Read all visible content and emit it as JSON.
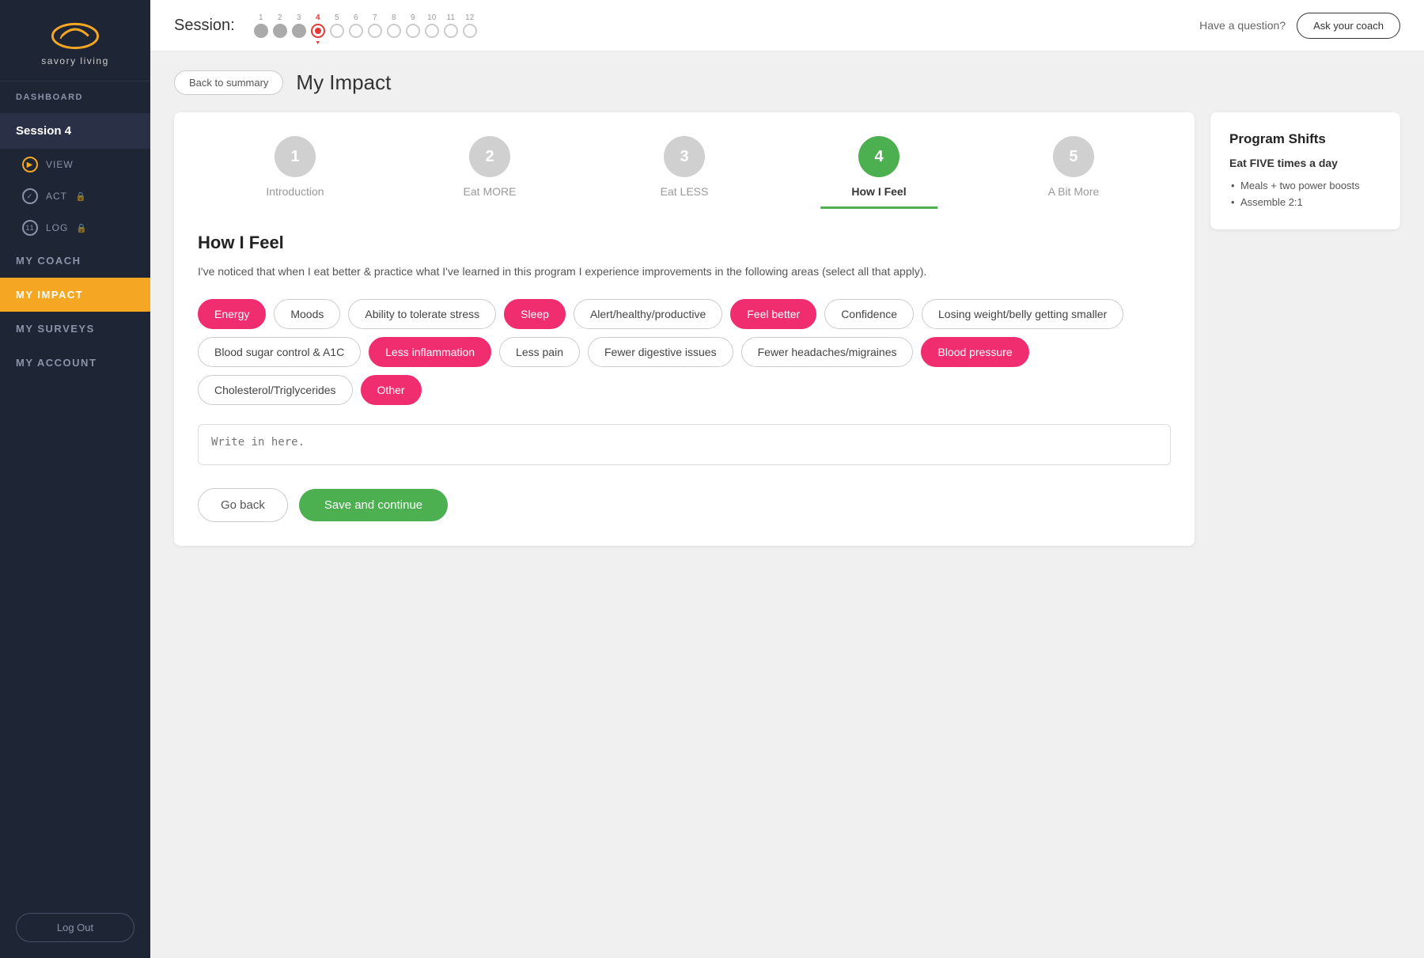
{
  "sidebar": {
    "logo_text": "savory living",
    "nav_items": [
      {
        "id": "dashboard",
        "label": "DASHBOARD",
        "type": "top"
      },
      {
        "id": "session4",
        "label": "Session 4",
        "type": "session"
      },
      {
        "id": "view",
        "label": "VIEW",
        "type": "sub",
        "icon": "play"
      },
      {
        "id": "act",
        "label": "ACT",
        "type": "sub",
        "icon": "check",
        "locked": true
      },
      {
        "id": "log",
        "label": "LOG",
        "type": "sub",
        "icon": "log",
        "locked": true
      },
      {
        "id": "my_coach",
        "label": "MY COACH",
        "type": "top"
      },
      {
        "id": "my_impact",
        "label": "MY IMPACT",
        "type": "top",
        "active": true
      },
      {
        "id": "my_surveys",
        "label": "MY SURVEYS",
        "type": "top"
      },
      {
        "id": "my_account",
        "label": "MY ACCOUNT",
        "type": "top"
      }
    ],
    "logout_label": "Log Out"
  },
  "topbar": {
    "session_label": "Session:",
    "have_question": "Have a question?",
    "ask_coach_label": "Ask your coach",
    "progress_dots": [
      {
        "number": "1",
        "state": "completed"
      },
      {
        "number": "2",
        "state": "completed"
      },
      {
        "number": "3",
        "state": "completed"
      },
      {
        "number": "4",
        "state": "active"
      },
      {
        "number": "5",
        "state": "empty"
      },
      {
        "number": "6",
        "state": "empty"
      },
      {
        "number": "7",
        "state": "empty"
      },
      {
        "number": "8",
        "state": "empty"
      },
      {
        "number": "9",
        "state": "empty"
      },
      {
        "number": "10",
        "state": "empty"
      },
      {
        "number": "11",
        "state": "empty"
      },
      {
        "number": "12",
        "state": "empty"
      }
    ]
  },
  "page": {
    "back_button": "Back to summary",
    "title": "My Impact",
    "steps": [
      {
        "number": "1",
        "label": "Introduction",
        "active": false
      },
      {
        "number": "2",
        "label": "Eat MORE",
        "active": false
      },
      {
        "number": "3",
        "label": "Eat LESS",
        "active": false
      },
      {
        "number": "4",
        "label": "How I Feel",
        "active": true
      },
      {
        "number": "5",
        "label": "A Bit More",
        "active": false
      }
    ],
    "section_title": "How I Feel",
    "section_description": "I've noticed that when I eat better & practice what I've learned in this program I experience improvements in the following areas (select all that apply).",
    "tags": [
      {
        "id": "energy",
        "label": "Energy",
        "selected": true
      },
      {
        "id": "moods",
        "label": "Moods",
        "selected": false
      },
      {
        "id": "stress",
        "label": "Ability to tolerate stress",
        "selected": false
      },
      {
        "id": "sleep",
        "label": "Sleep",
        "selected": true
      },
      {
        "id": "alert",
        "label": "Alert/healthy/productive",
        "selected": false
      },
      {
        "id": "feel_better",
        "label": "Feel better",
        "selected": true
      },
      {
        "id": "confidence",
        "label": "Confidence",
        "selected": false
      },
      {
        "id": "losing_weight",
        "label": "Losing weight/belly getting smaller",
        "selected": false
      },
      {
        "id": "blood_sugar",
        "label": "Blood sugar control & A1C",
        "selected": false
      },
      {
        "id": "less_inflammation",
        "label": "Less inflammation",
        "selected": true
      },
      {
        "id": "less_pain",
        "label": "Less pain",
        "selected": false
      },
      {
        "id": "digestive",
        "label": "Fewer digestive issues",
        "selected": false
      },
      {
        "id": "headaches",
        "label": "Fewer headaches/migraines",
        "selected": false
      },
      {
        "id": "blood_pressure",
        "label": "Blood pressure",
        "selected": true
      },
      {
        "id": "cholesterol",
        "label": "Cholesterol/Triglycerides",
        "selected": false
      },
      {
        "id": "other",
        "label": "Other",
        "selected": true
      }
    ],
    "write_in_placeholder": "Write in here.",
    "go_back_label": "Go back",
    "save_continue_label": "Save and continue"
  },
  "sidebar_card": {
    "title": "Program Shifts",
    "subtitle": "Eat FIVE times a day",
    "list_items": [
      "Meals + two power boosts",
      "Assemble 2:1"
    ]
  }
}
